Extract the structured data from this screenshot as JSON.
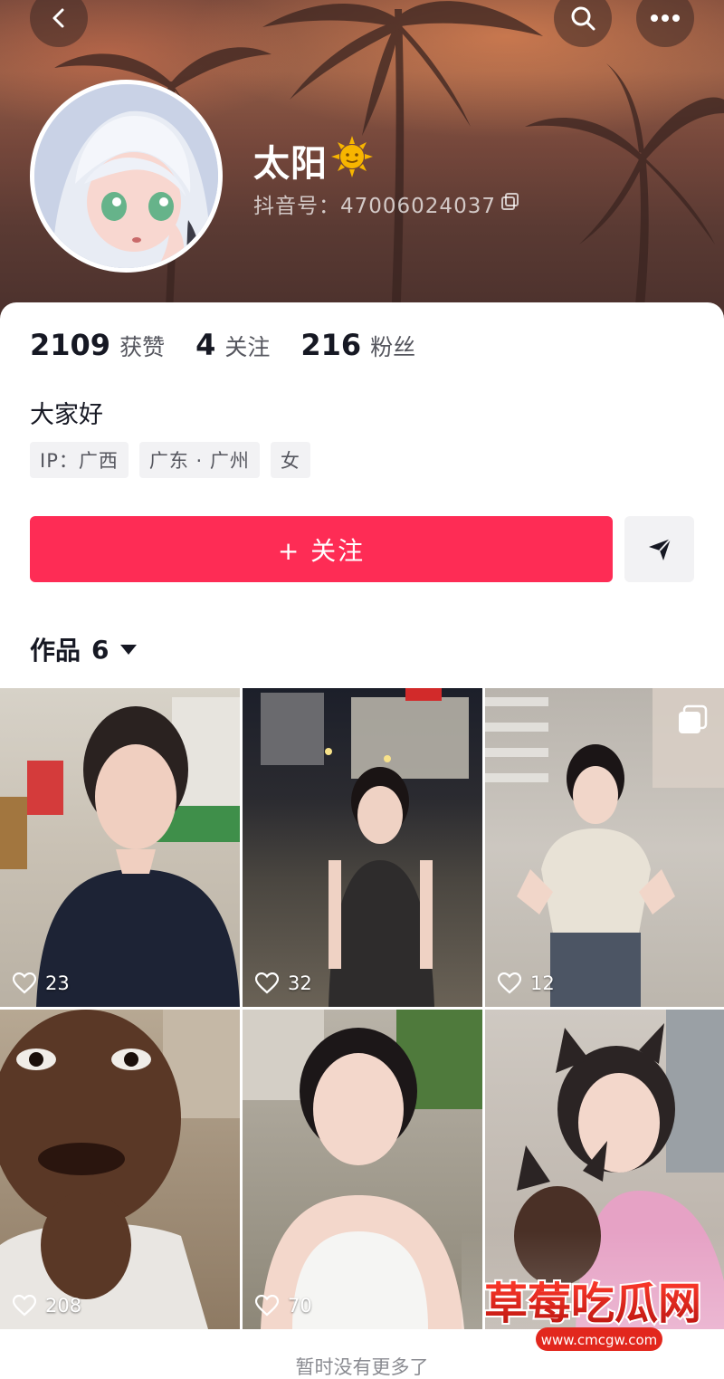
{
  "header": {
    "nickname": "太阳",
    "douyin_id": "抖音号：47006024037",
    "icons": [
      "back-icon",
      "search-icon",
      "more-icon",
      "sun-emoji-icon",
      "copy-icon"
    ]
  },
  "stats": [
    {
      "value": "2109",
      "label": "获赞"
    },
    {
      "value": "4",
      "label": "关注"
    },
    {
      "value": "216",
      "label": "粉丝"
    }
  ],
  "bio": "大家好",
  "tags": [
    "IP：广西",
    "广东 · 广州",
    "女"
  ],
  "actions": {
    "follow_label": "+ 关注",
    "follow_color": "#fe2c55",
    "share_icon": "send-icon"
  },
  "works": {
    "label": "作品",
    "count": "6"
  },
  "videos": [
    {
      "likes": "23"
    },
    {
      "likes": "32"
    },
    {
      "likes": "12"
    },
    {
      "likes": "208"
    },
    {
      "likes": "70"
    },
    {
      "likes": ""
    }
  ],
  "footer": {
    "no_more": "暂时没有更多了"
  },
  "watermark": {
    "title": "草莓吃瓜网",
    "url": "www.cmcgw.com"
  }
}
